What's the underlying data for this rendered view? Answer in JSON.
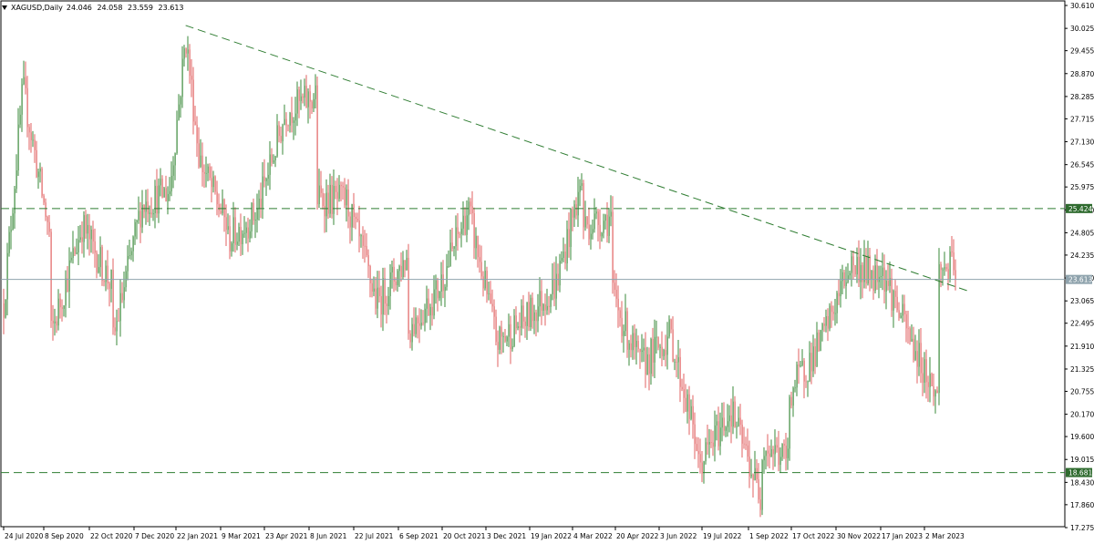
{
  "header": {
    "symbol": "XAGUSD,Daily",
    "open": "24.046",
    "high": "24.058",
    "low": "23.559",
    "close": "23.613"
  },
  "chart_data": {
    "type": "candlestick",
    "symbol": "XAGUSD,Daily",
    "ylim": [
      17.275,
      30.61
    ],
    "y_ticks": [
      "30.610",
      "30.025",
      "29.455",
      "28.870",
      "28.285",
      "27.715",
      "27.130",
      "26.545",
      "25.975",
      "25.390",
      "24.805",
      "24.235",
      "23.650",
      "23.065",
      "22.495",
      "21.910",
      "21.325",
      "20.755",
      "20.170",
      "19.600",
      "19.015",
      "18.430",
      "17.860",
      "17.275"
    ],
    "x_ticks": [
      "24 Jul 2020",
      "8 Sep 2020",
      "22 Oct 2020",
      "7 Dec 2020",
      "22 Jan 2021",
      "9 Mar 2021",
      "23 Apr 2021",
      "8 Jun 2021",
      "22 Jul 2021",
      "6 Sep 2021",
      "20 Oct 2021",
      "3 Dec 2021",
      "19 Jan 2022",
      "4 Mar 2022",
      "20 Apr 2022",
      "3 Jun 2022",
      "19 Jul 2022",
      "1 Sep 2022",
      "17 Oct 2022",
      "30 Nov 2022",
      "17 Jan 2023",
      "2 Mar 2023"
    ],
    "price_path": [
      [
        "24 Jul 2020",
        23.0
      ],
      [
        "Aug 2020",
        28.5
      ],
      [
        "Sep 2020",
        24.5
      ],
      [
        "Sep 2020",
        22.2
      ],
      [
        "Oct 2020",
        25.0
      ],
      [
        "Nov 2020",
        23.4
      ],
      [
        "Nov 2020",
        22.0
      ],
      [
        "Dec 2020",
        25.5
      ],
      [
        "Jan 2021",
        25.9
      ],
      [
        "1 Feb 2021",
        29.8
      ],
      [
        "Feb 2021",
        26.7
      ],
      [
        "Mar 2021",
        25.0
      ],
      [
        "Mar 2021",
        24.6
      ],
      [
        "Apr 2021",
        25.3
      ],
      [
        "May 2021",
        27.9
      ],
      [
        "Jun 2021",
        28.3
      ],
      [
        "Jun 2021",
        25.7
      ],
      [
        "Jul 2021",
        25.6
      ],
      [
        "Aug 2021",
        23.0
      ],
      [
        "Sep 2021",
        24.2
      ],
      [
        "Sep 2021",
        22.3
      ],
      [
        "Oct 2021",
        23.3
      ],
      [
        "Nov 2021",
        25.4
      ],
      [
        "Dec 2021",
        22.0
      ],
      [
        "Jan 2022",
        22.6
      ],
      [
        "Feb 2022",
        23.5
      ],
      [
        "Mar 2022",
        26.2
      ],
      [
        "Mar 2022",
        25.0
      ],
      [
        "Apr 2022",
        25.2
      ],
      [
        "Apr 2022",
        23.3
      ],
      [
        "May 2022",
        21.4
      ],
      [
        "Jun 2022",
        22.2
      ],
      [
        "Jul 2022",
        19.2
      ],
      [
        "Jul 2022",
        18.8
      ],
      [
        "Aug 2022",
        20.3
      ],
      [
        "Sep 2022",
        18.0
      ],
      [
        "Sep 2022",
        19.4
      ],
      [
        "Oct 2022",
        19.0
      ],
      [
        "Oct 2022",
        20.7
      ],
      [
        "Nov 2022",
        22.0
      ],
      [
        "Dec 2022",
        24.0
      ],
      [
        "Jan 2023",
        23.7
      ],
      [
        "Jan 2023",
        24.1
      ],
      [
        "Feb 2023",
        22.1
      ],
      [
        "Mar 2023",
        20.6
      ],
      [
        "Mar 2023",
        21.9
      ],
      [
        "Mar 2023",
        23.9
      ]
    ],
    "horizontal_lines": [
      {
        "price": 25.424,
        "label": "25.424",
        "style": "dashed",
        "color": "#2f7d32"
      },
      {
        "price": 18.681,
        "label": "18.681",
        "style": "dashed",
        "color": "#2f7d32"
      },
      {
        "price": 23.613,
        "label": "23.613",
        "style": "solid",
        "color": "#8fa3ad"
      }
    ],
    "trendline": {
      "style": "dashed",
      "color": "#2f7d32",
      "points": [
        [
          "1 Feb 2021",
          30.1
        ],
        [
          "17 Apr 2023",
          23.3
        ]
      ]
    },
    "bull_color": "#3a8a3a",
    "bear_color": "#e06060",
    "grid": false
  }
}
